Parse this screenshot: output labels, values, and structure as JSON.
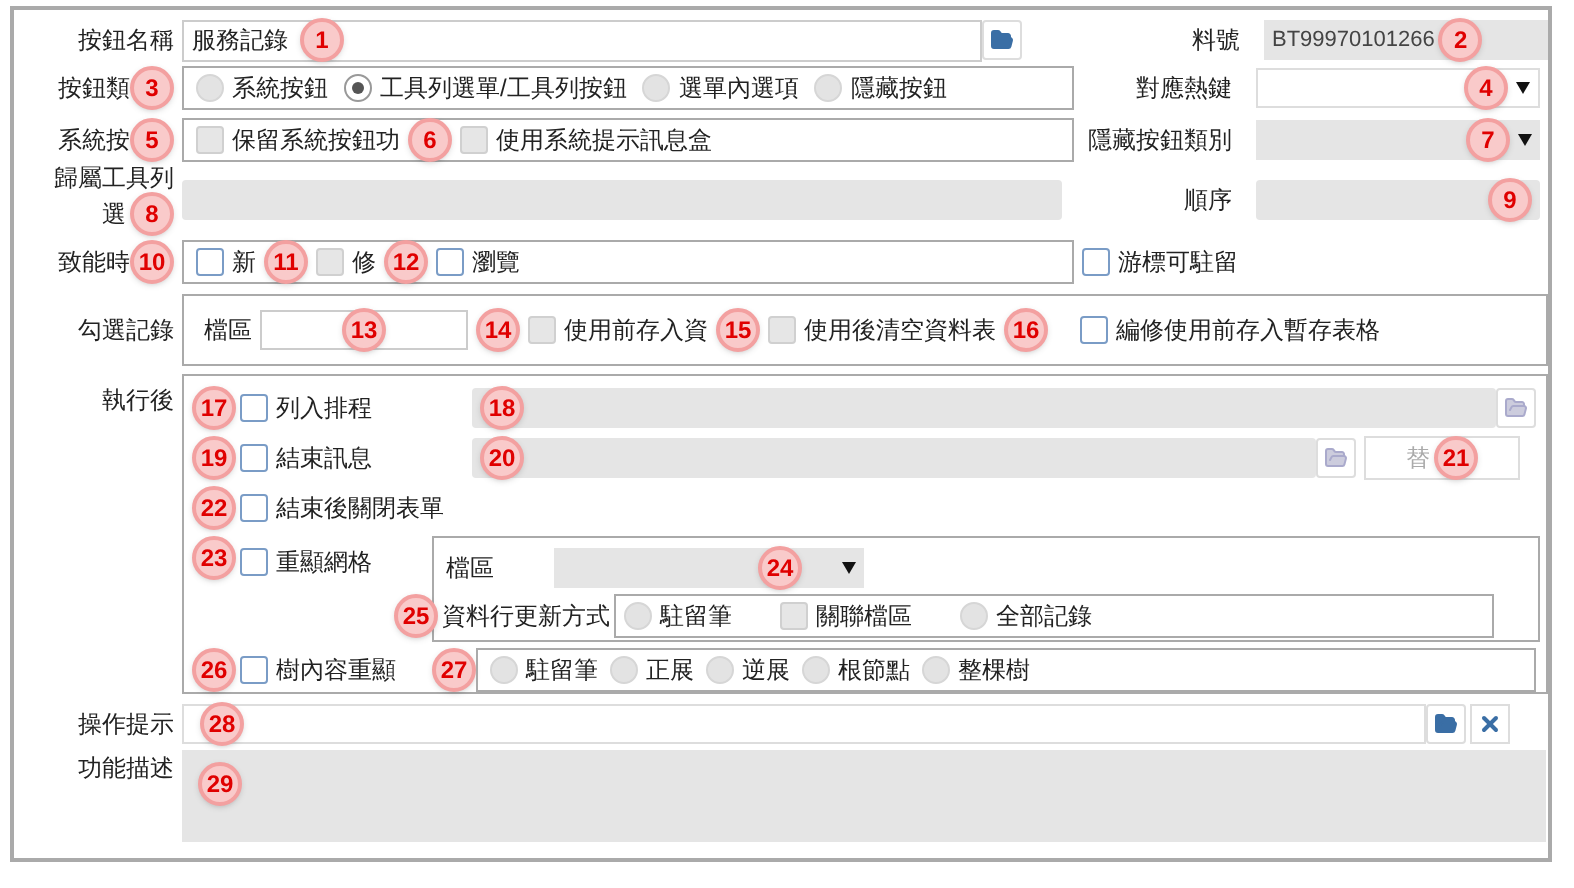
{
  "button_name": {
    "label": "按鈕名稱",
    "value": "服務記錄"
  },
  "item_no": {
    "label": "料號",
    "value": "BT99970101266"
  },
  "button_type": {
    "label": "按鈕類",
    "options": [
      {
        "label": "系統按鈕",
        "selected": false
      },
      {
        "label": "工具列選單/工具列按鈕",
        "selected": true
      },
      {
        "label": "選單內選項",
        "selected": false
      },
      {
        "label": "隱藏按鈕",
        "selected": false
      }
    ]
  },
  "hotkey": {
    "label": "對應熱鍵"
  },
  "system_button": {
    "label": "系統按",
    "options": [
      {
        "label": "保留系統按鈕功",
        "checked": false,
        "disabled": true
      },
      {
        "label": "使用系統提示訊息盒",
        "checked": false,
        "disabled": true
      }
    ]
  },
  "hidden_button_category": {
    "label": "隱藏按鈕類別"
  },
  "toolbar_menu": {
    "label_lines": [
      "歸屬工具列",
      "選"
    ]
  },
  "order": {
    "label": "順序"
  },
  "enable_timing": {
    "label": "致能時",
    "options": [
      {
        "label": "新",
        "checked": false,
        "disabled": false
      },
      {
        "label": "修",
        "checked": false,
        "disabled": true
      },
      {
        "label": "瀏覽",
        "checked": false,
        "disabled": false
      }
    ]
  },
  "cursor_stay": {
    "label": "游標可駐留",
    "checked": false
  },
  "check_records": {
    "label": "勾選記錄",
    "area_label": "檔區",
    "options": [
      {
        "label": "使用前存入資",
        "checked": false,
        "disabled": true
      },
      {
        "label": "使用後清空資料表",
        "checked": false,
        "disabled": true
      }
    ],
    "edit_option": {
      "label": "編修使用前存入暫存表格",
      "checked": false
    }
  },
  "after_execution": {
    "label": "執行後",
    "schedule": {
      "label": "列入排程",
      "checked": false
    },
    "end_message": {
      "label": "結束訊息",
      "checked": false,
      "button": "替"
    },
    "close_form": {
      "label": "結束後關閉表單",
      "checked": false
    },
    "redisplay_grid": {
      "label": "重顯網格",
      "checked": false,
      "area_label": "檔區",
      "update_label": "資料行更新方式",
      "update_options": [
        {
          "kind": "radio",
          "label": "駐留筆",
          "selected": false
        },
        {
          "kind": "checkbox",
          "label": "關聯檔區",
          "checked": false,
          "disabled": true
        },
        {
          "kind": "radio",
          "label": "全部記錄",
          "selected": false
        }
      ]
    },
    "tree_redisplay": {
      "label": "樹內容重顯",
      "checked": false,
      "options": [
        {
          "label": "駐留筆",
          "selected": false
        },
        {
          "label": "正展",
          "selected": false
        },
        {
          "label": "逆展",
          "selected": false
        },
        {
          "label": "根節點",
          "selected": false
        },
        {
          "label": "整棵樹",
          "selected": false
        }
      ]
    }
  },
  "hint": {
    "label": "操作提示"
  },
  "description": {
    "label": "功能描述"
  },
  "annotations": [
    {
      "label": "1"
    },
    {
      "label": "2"
    },
    {
      "label": "3"
    },
    {
      "label": "4"
    },
    {
      "label": "5"
    },
    {
      "label": "6"
    },
    {
      "label": "7"
    },
    {
      "label": "8"
    },
    {
      "label": "9"
    },
    {
      "label": "10"
    },
    {
      "label": "11"
    },
    {
      "label": "12"
    },
    {
      "label": "13"
    },
    {
      "label": "14"
    },
    {
      "label": "15"
    },
    {
      "label": "16"
    },
    {
      "label": "17"
    },
    {
      "label": "18"
    },
    {
      "label": "19"
    },
    {
      "label": "20"
    },
    {
      "label": "21"
    },
    {
      "label": "22"
    },
    {
      "label": "23"
    },
    {
      "label": "24"
    },
    {
      "label": "25"
    },
    {
      "label": "26"
    },
    {
      "label": "27"
    },
    {
      "label": "28"
    },
    {
      "label": "29"
    }
  ]
}
